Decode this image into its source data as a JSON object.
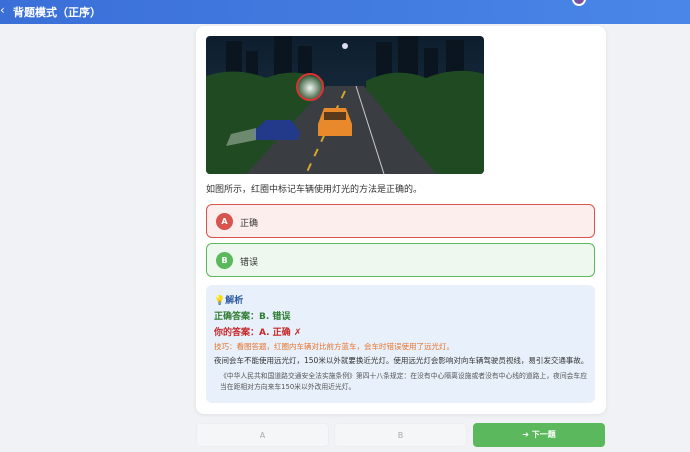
{
  "header": {
    "back_glyph": "‹",
    "title": "背题模式（正序）"
  },
  "question": {
    "text": "如图所示，红圈中标记车辆使用灯光的方法是正确的。",
    "image_alt": "night road scene"
  },
  "options": [
    {
      "letter": "A",
      "text": "正确",
      "state": "wrong"
    },
    {
      "letter": "B",
      "text": "错误",
      "state": "correct"
    }
  ],
  "analysis": {
    "icon": "lightbulb-icon",
    "title": "解析",
    "correct_answer": "正确答案：B. 错误",
    "your_answer": "你的答案：A. 正确 ✗",
    "tip": "技巧：看图答题，红圈内车辆对比前方蓝车，会车时错误使用了远光灯。",
    "explain": "夜间会车不能使用远光灯，150米以外就要换近光灯。使用远光灯会影响对向车辆驾驶员视线，易引发交通事故。",
    "law": "《中华人民共和国道路交通安全法实施条例》第四十八条规定：在没有中心隔离设施或者没有中心线的道路上，夜间会车应当在距相对方向来车150米以外改用近光灯。"
  },
  "footer": {
    "btn_a": "A",
    "btn_b": "B",
    "btn_next": "➔ 下一题"
  },
  "colors": {
    "header": "#4a86e8",
    "wrong": "#d9534f",
    "correct": "#5cb85c"
  }
}
